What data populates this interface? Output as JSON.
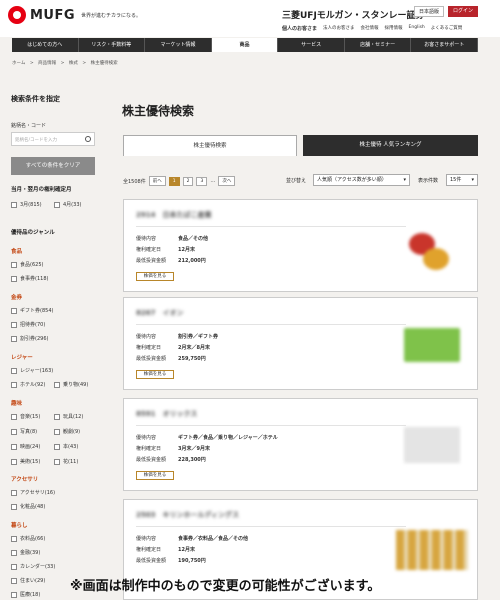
{
  "header": {
    "logo": "MUFG",
    "tagline": "世界が進むチカラになる。",
    "brand": "三菱UFJモルガン・スタンレー証券",
    "btn_jp": "日本語版",
    "btn_login": "ログイン",
    "links": [
      "個人のお客さま",
      "法人のお客さま",
      "会社情報",
      "採用情報",
      "English",
      "よくあるご質問"
    ]
  },
  "nav": [
    "はじめての方へ",
    "リスク・手数料等",
    "マーケット情報",
    "商品",
    "サービス",
    "店舗・セミナー",
    "お客さまサポート"
  ],
  "breadcrumb": "ホーム　>　商品情報　>　株式　>　株主優待検索",
  "sidebar": {
    "heading": "検索条件を指定",
    "name_label": "銘柄名・コード",
    "name_placeholder": "銘柄名/コードを入力",
    "clear": "すべての条件をクリア",
    "month_label": "当月・翌月の権利確定月",
    "month": [
      "3月(815)",
      "4月(33)"
    ],
    "genre_label": "優待品のジャンル",
    "groups": [
      {
        "name": "食品",
        "items": [
          "食品(625)",
          "食事券(118)"
        ]
      },
      {
        "name": "金券",
        "items": [
          "ギフト券(854)",
          "招待券(70)",
          "割引券(296)"
        ]
      },
      {
        "name": "レジャー",
        "items": [
          "レジャー(163)",
          "ホテル(92)",
          "乗り物(49)"
        ]
      },
      {
        "name": "趣味",
        "items": [
          "音楽(15)",
          "玩具(12)",
          "写真(8)",
          "観劇(9)",
          "映画(24)",
          "本(43)",
          "美術(15)",
          "花(11)"
        ]
      },
      {
        "name": "アクセサリ",
        "items": [
          "アクセサリ(16)",
          "化粧品(48)"
        ]
      },
      {
        "name": "暮らし",
        "items": [
          "衣料品(66)",
          "金融(39)",
          "カレンダー(33)",
          "住まい(29)",
          "医療(18)"
        ]
      }
    ]
  },
  "main": {
    "title": "株主優待検索",
    "tab1": "株主優待検索",
    "tab2": "株主優待 人気ランキング",
    "count": "全1508件",
    "prev": "前へ",
    "pages": [
      "1",
      "2",
      "3"
    ],
    "ellipsis": "…",
    "next": "次へ",
    "sort_label": "並び替え",
    "sort_value": "人気順（アクセス数が多い順）",
    "per_label": "表示件数",
    "per_value": "15件",
    "keys": [
      "優待内容",
      "権利確定日",
      "最低投資金額"
    ],
    "detail_btn": "株価を見る",
    "cards": [
      {
        "title": "2914　日本たばこ産業",
        "content": "食品／その他",
        "date": "12月末",
        "amount": "212,000円"
      },
      {
        "title": "8267　イオン",
        "content": "割引券／ギフト券",
        "date": "2月末／8月末",
        "amount": "259,750円"
      },
      {
        "title": "8591　オリックス",
        "content": "ギフト券／食品／乗り物／レジャー／ホテル",
        "date": "3月末／9月末",
        "amount": "228,300円"
      },
      {
        "title": "2503　キリンホールディングス",
        "content": "食事券／衣料品／食品／その他",
        "date": "12月末",
        "amount": "190,750円"
      }
    ]
  },
  "note": "※画面は制作中のもので変更の可能性がございます。"
}
